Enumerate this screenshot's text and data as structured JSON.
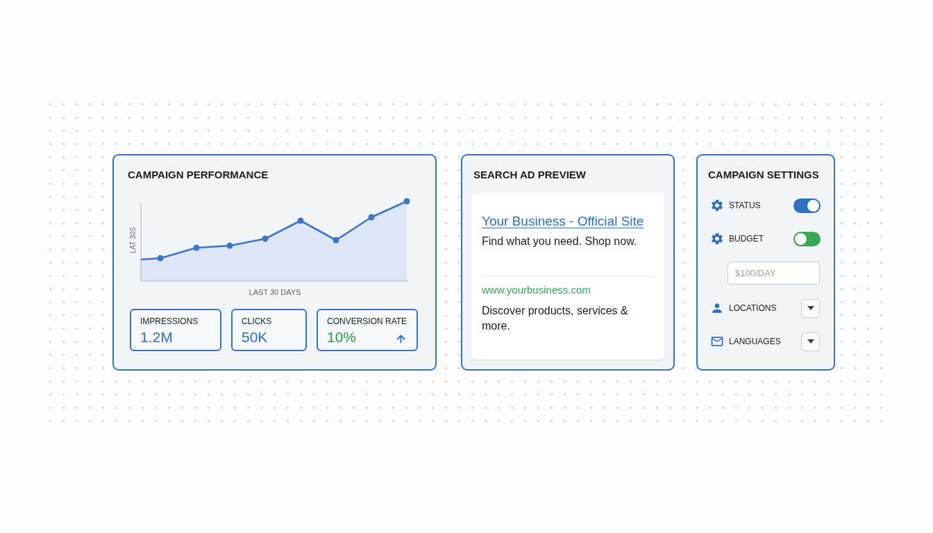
{
  "performance": {
    "title": "CAMPAIGN PERFORMANCE",
    "chart": {
      "ylabel": "LAT 30S",
      "xlabel": "LAST 30 DAYS"
    },
    "stats": [
      {
        "kind": "plain",
        "label": "IMPRESSIONS",
        "value": "1.2M",
        "color": "#2f6fc6"
      },
      {
        "kind": "plain",
        "label": "CLICKS",
        "value": "50K",
        "color": "#2f6fc6"
      },
      {
        "kind": "trend",
        "label": "CONVERSION RATE",
        "value": "10%",
        "color": "#22a045"
      }
    ]
  },
  "ad_preview": {
    "title": "SEARCH AD PREVIEW",
    "headline": "Your Business - Official Site",
    "tagline": "Find what you need. Shop now.",
    "url": "www.yourbusiness.com",
    "description": "Discover products, services & more."
  },
  "settings": {
    "title": "CAMPAIGN SETTINGS",
    "items": [
      {
        "kind": "toggle",
        "label": "STATUS",
        "on": true,
        "color": "#2f6fc6"
      },
      {
        "kind": "toggle",
        "label": "BUDGET",
        "on": false,
        "color": "#34a853"
      },
      {
        "kind": "field",
        "placeholder": "$100/DAY"
      },
      {
        "kind": "dropdown",
        "label": "LOCATIONS"
      },
      {
        "kind": "dropdown",
        "label": "LANGUAGES"
      }
    ]
  }
}
